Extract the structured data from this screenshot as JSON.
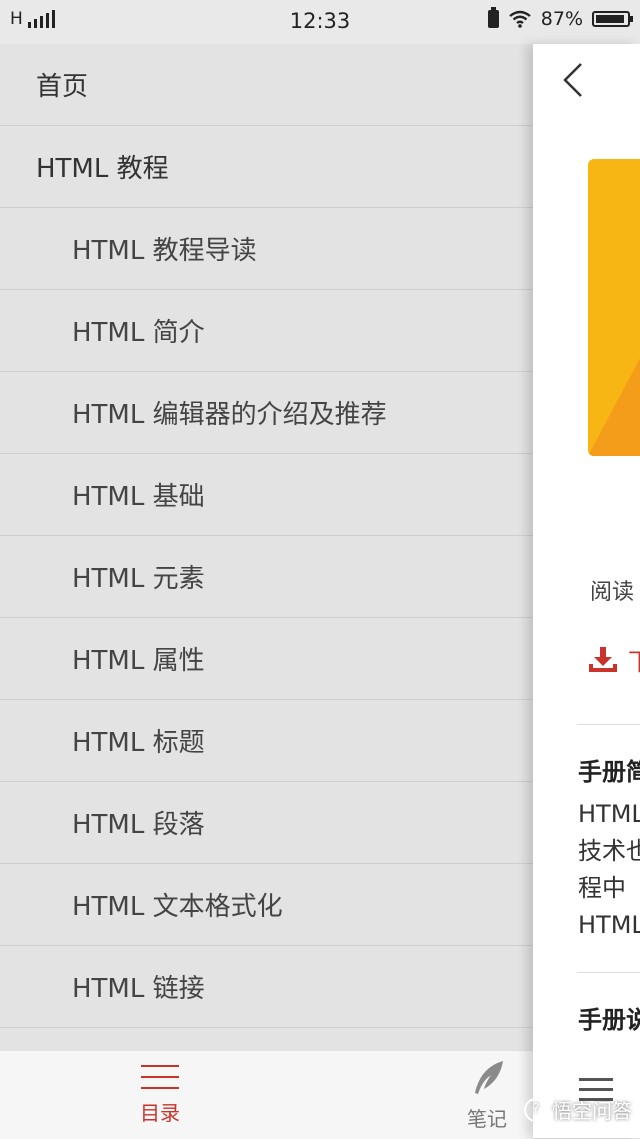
{
  "status_bar": {
    "network": "H",
    "time": "12:33",
    "battery": "87%"
  },
  "toc": {
    "items": [
      {
        "label": "首页",
        "level": 1
      },
      {
        "label": "HTML 教程",
        "level": 1
      },
      {
        "label": "HTML 教程导读",
        "level": 2
      },
      {
        "label": "HTML 简介",
        "level": 2
      },
      {
        "label": "HTML 编辑器的介绍及推荐",
        "level": 2
      },
      {
        "label": "HTML 基础",
        "level": 2
      },
      {
        "label": "HTML 元素",
        "level": 2
      },
      {
        "label": "HTML 属性",
        "level": 2
      },
      {
        "label": "HTML 标题",
        "level": 2
      },
      {
        "label": "HTML 段落",
        "level": 2
      },
      {
        "label": "HTML 文本格式化",
        "level": 2
      },
      {
        "label": "HTML 链接",
        "level": 2
      }
    ]
  },
  "detail": {
    "read_label": "阅读",
    "download_label": "下",
    "section1_title": "手册简",
    "desc_lines": [
      "HTML",
      "技术也",
      "程中",
      "HTML"
    ],
    "section2_title": "手册说"
  },
  "tabbar": {
    "directory_label": "目录",
    "notes_label": "笔记"
  },
  "watermark": "悟空问答",
  "colors": {
    "accent": "#c9332b",
    "cover": "#f8b614"
  }
}
